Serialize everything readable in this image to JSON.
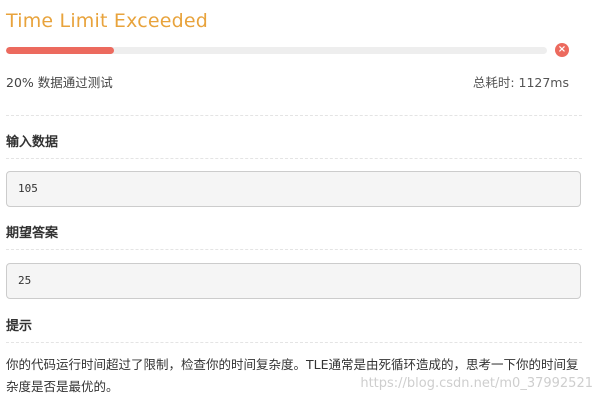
{
  "result": {
    "title": "Time Limit Exceeded",
    "progress_fraction": 0.2,
    "status_icon": "×",
    "pass_rate": "20%  数据通过测试",
    "time_used": "总耗时: 1127ms"
  },
  "sections": {
    "input_heading": "输入数据",
    "input_value": "105",
    "expected_heading": "期望答案",
    "expected_value": "25",
    "hint_heading": "提示",
    "hint_text": "你的代码运行时间超过了限制，检查你的时间复杂度。TLE通常是由死循环造成的，思考一下你的时间复杂度是否是最优的。"
  },
  "watermark": "https://blog.csdn.net/m0_37992521",
  "colors": {
    "title": "#e8a33c",
    "progress": "#ec6a5e",
    "track": "#eeeeee"
  }
}
